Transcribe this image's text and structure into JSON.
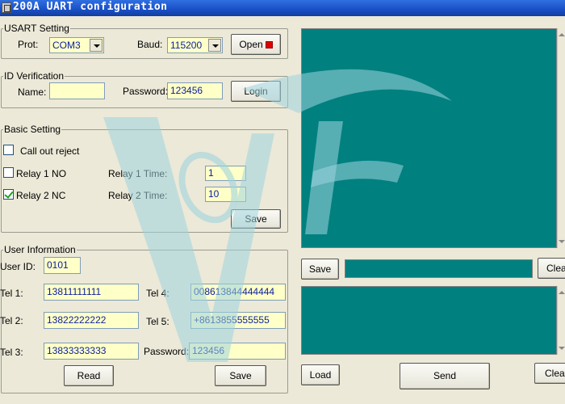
{
  "window": {
    "title": "200A UART configuration"
  },
  "usart": {
    "legend": "USART Setting",
    "prot_label": "Prot:",
    "prot_value": "COM3",
    "baud_label": "Baud:",
    "baud_value": "115200",
    "open_label": "Open"
  },
  "id_verification": {
    "legend": "ID Verification",
    "name_label": "Name:",
    "name_value": "",
    "password_label": "Password:",
    "password_value": "123456",
    "login_label": "Login"
  },
  "basic": {
    "legend": "Basic Setting",
    "call_out_reject": {
      "label": "Call out reject",
      "checked": false
    },
    "relay1": {
      "label": "Relay 1 NO",
      "checked": false,
      "time_label": "Relay 1 Time:",
      "time_value": "1"
    },
    "relay2": {
      "label": "Relay 2 NC",
      "checked": true,
      "time_label": "Relay 2 Time:",
      "time_value": "10"
    },
    "save_label": "Save"
  },
  "user_info": {
    "legend": "User Information",
    "user_id_label": "User ID:",
    "user_id_value": "0101",
    "tel1_label": "Tel 1:",
    "tel1_value": "13811111111",
    "tel2_label": "Tel 2:",
    "tel2_value": "13822222222",
    "tel3_label": "Tel 3:",
    "tel3_value": "13833333333",
    "tel4_label": "Tel 4:",
    "tel4_value": "008613844444444",
    "tel5_label": "Tel 5:",
    "tel5_value": "+8613855555555",
    "password_label": "Password:",
    "password_value": "123456",
    "read_label": "Read",
    "save_label": "Save"
  },
  "right_panel": {
    "save_label": "Save",
    "clear_top_label": "Clea",
    "load_label": "Load",
    "send_label": "Send",
    "clear_bottom_label": "Clear"
  },
  "colors": {
    "title_bar": "#1a4fc7",
    "input_bg": "#ffffc8",
    "pane_bg": "#00807f",
    "led_red": "#e00000",
    "watermark": "#9fd3de"
  }
}
